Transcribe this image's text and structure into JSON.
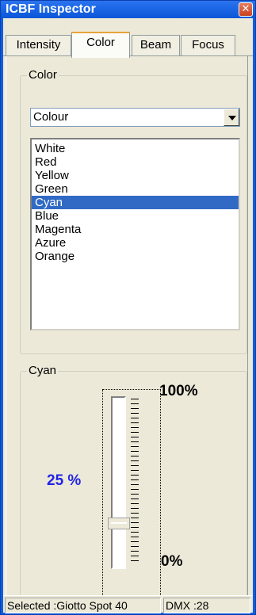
{
  "window": {
    "title": "ICBF Inspector",
    "close_glyph": "✕"
  },
  "tabs": [
    {
      "label": "Intensity"
    },
    {
      "label": "Color",
      "active": true
    },
    {
      "label": "Beam"
    },
    {
      "label": "Focus"
    }
  ],
  "color_group": {
    "label": "Color",
    "combo_value": "Colour",
    "list_items": [
      "White",
      "Red",
      "Yellow",
      "Green",
      "Cyan",
      "Blue",
      "Magenta",
      "Azure",
      "Orange"
    ],
    "selected_index": 4
  },
  "slider_group": {
    "label": "Cyan",
    "value_text": "25 %",
    "value_percent": 25,
    "max_label": "100%",
    "min_label": "0%"
  },
  "statusbar": {
    "selected": "Selected :Giotto Spot 40",
    "dmx": "DMX :28"
  },
  "colors": {
    "selection": "#316ac5",
    "value_text": "#2323e6",
    "titlebar": "#0a56d8"
  }
}
